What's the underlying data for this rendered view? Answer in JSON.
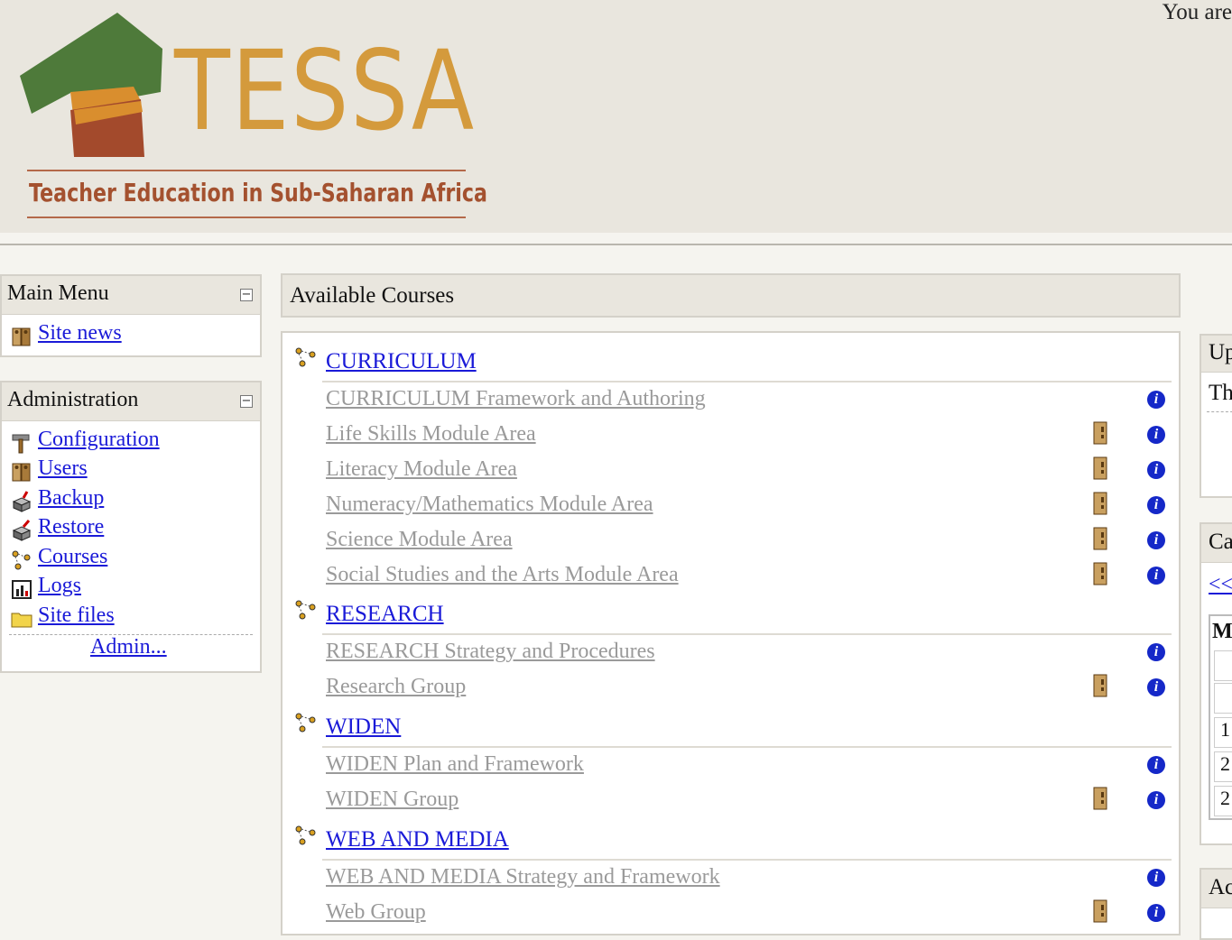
{
  "header": {
    "login_info": "You are",
    "logo_word": "TESSA",
    "tagline": "Teacher Education in Sub-Saharan Africa",
    "colors": {
      "logo_green": "#4e7a3a",
      "logo_orange": "#d49a3c",
      "logo_brown": "#a4512f"
    }
  },
  "main_menu": {
    "title": "Main Menu",
    "items": [
      {
        "label": "Site news",
        "icon": "users-icon"
      }
    ]
  },
  "administration": {
    "title": "Administration",
    "items": [
      {
        "label": "Configuration",
        "icon": "hammer-icon"
      },
      {
        "label": "Users",
        "icon": "users-icon"
      },
      {
        "label": "Backup",
        "icon": "backup-icon"
      },
      {
        "label": "Restore",
        "icon": "restore-icon"
      },
      {
        "label": "Courses",
        "icon": "course-category-icon"
      },
      {
        "label": "Logs",
        "icon": "logs-icon"
      },
      {
        "label": "Site files",
        "icon": "folder-icon"
      }
    ],
    "more_label": "Admin..."
  },
  "available_courses": {
    "title": "Available Courses",
    "categories": [
      {
        "name": "CURRICULUM",
        "courses": [
          {
            "name": "CURRICULUM Framework and Authoring",
            "guest": false
          },
          {
            "name": "Life Skills Module Area",
            "guest": true
          },
          {
            "name": "Literacy Module Area",
            "guest": true
          },
          {
            "name": "Numeracy/Mathematics Module Area",
            "guest": true
          },
          {
            "name": "Science Module Area",
            "guest": true
          },
          {
            "name": "Social Studies and the Arts Module Area",
            "guest": true
          }
        ]
      },
      {
        "name": "RESEARCH",
        "courses": [
          {
            "name": "RESEARCH Strategy and Procedures",
            "guest": false
          },
          {
            "name": "Research Group",
            "guest": true
          }
        ]
      },
      {
        "name": "WIDEN",
        "courses": [
          {
            "name": "WIDEN Plan and Framework",
            "guest": false
          },
          {
            "name": "WIDEN Group",
            "guest": true
          }
        ]
      },
      {
        "name": "WEB AND MEDIA",
        "courses": [
          {
            "name": "WEB AND MEDIA Strategy and Framework",
            "guest": false
          },
          {
            "name": "Web Group",
            "guest": true
          }
        ]
      }
    ]
  },
  "right_column": {
    "upcoming_title": "Up",
    "upcoming_text": "Th",
    "calendar_title": "Ca",
    "calendar_prev": "<<",
    "calendar_header_cell": "M",
    "calendar_cells": [
      "",
      "",
      "1",
      "2",
      "2"
    ],
    "activity_title": "Ac"
  }
}
